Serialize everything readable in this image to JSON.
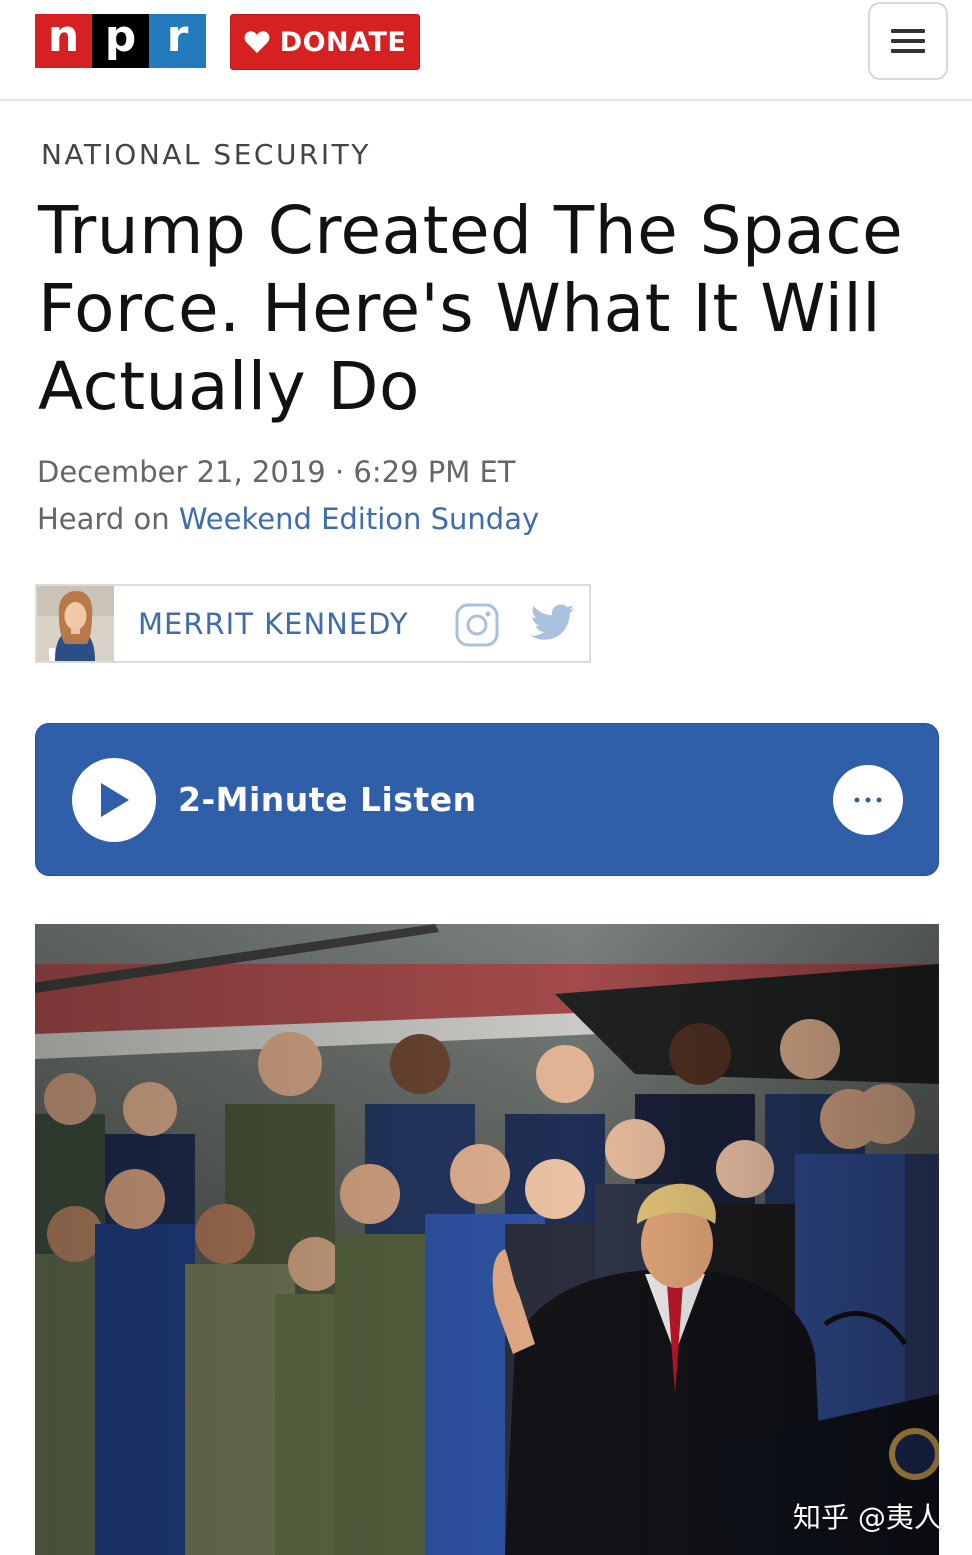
{
  "header": {
    "logo": {
      "letters": [
        "n",
        "p",
        "r"
      ],
      "colors": [
        "#d62021",
        "#000000",
        "#237bbd"
      ]
    },
    "donate_label": "DONATE",
    "donate_icon": "heart-icon",
    "menu_icon": "hamburger-menu-icon"
  },
  "article": {
    "section": "NATIONAL SECURITY",
    "headline": "Trump Created The Space Force. Here's What It Will Actually Do",
    "date": "December 21, 2019 · 6:29 PM ET",
    "heard_prefix": "Heard on ",
    "program": "Weekend Edition Sunday",
    "author": {
      "name": "MERRIT KENNEDY",
      "social": [
        "instagram-icon",
        "twitter-icon"
      ]
    }
  },
  "player": {
    "label": "2-Minute Listen",
    "play_icon": "play-icon",
    "more_icon": "more-options-icon"
  },
  "watermark": "知乎 @夷人",
  "colors": {
    "npr_red": "#d62021",
    "npr_blue": "#237bbd",
    "player_blue": "#2f5fa8",
    "link_blue": "#3f6cad"
  }
}
